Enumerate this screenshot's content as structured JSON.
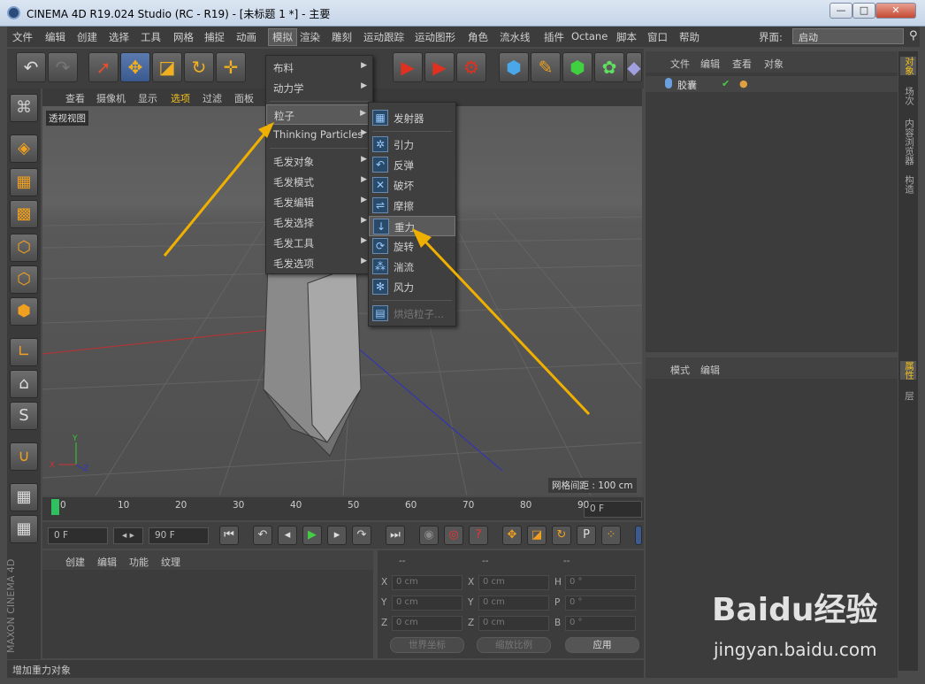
{
  "window": {
    "title": "CINEMA 4D R19.024 Studio (RC - R19) - [未标题 1 *] - 主要"
  },
  "menubar": {
    "items": [
      "文件",
      "编辑",
      "创建",
      "选择",
      "工具",
      "网格",
      "捕捉",
      "动画",
      "模拟",
      "渲染",
      "雕刻",
      "运动跟踪",
      "运动图形",
      "角色",
      "流水线",
      "插件",
      "Octane",
      "脚本",
      "窗口",
      "帮助"
    ],
    "open_item": "模拟",
    "layout_label": "界面:",
    "layout_value": "启动"
  },
  "viewport_bar": {
    "items": [
      "查看",
      "摄像机",
      "显示",
      "选项",
      "过滤",
      "面板"
    ],
    "active": "选项"
  },
  "viewport": {
    "label": "透视视图",
    "grid_info": "网格间距 : 100 cm",
    "axis_labels": [
      "Y",
      "X",
      "Z"
    ]
  },
  "simulate_menu": {
    "items": [
      {
        "label": "布料",
        "submenu": true
      },
      {
        "label": "动力学",
        "submenu": true
      },
      {
        "label": "粒子",
        "submenu": true,
        "selected": true
      },
      {
        "label": "Thinking Particles",
        "submenu": true
      },
      {
        "label": "毛发对象",
        "submenu": true
      },
      {
        "label": "毛发模式",
        "submenu": true
      },
      {
        "label": "毛发编辑",
        "submenu": true
      },
      {
        "label": "毛发选择",
        "submenu": true
      },
      {
        "label": "毛发工具",
        "submenu": true
      },
      {
        "label": "毛发选项",
        "submenu": true
      }
    ]
  },
  "particles_menu": {
    "items": [
      {
        "label": "发射器",
        "icon": "emitter-icon"
      },
      {
        "label": "引力",
        "icon": "attractor-icon"
      },
      {
        "label": "反弹",
        "icon": "deflector-icon"
      },
      {
        "label": "破坏",
        "icon": "destructor-icon"
      },
      {
        "label": "摩擦",
        "icon": "friction-icon"
      },
      {
        "label": "重力",
        "icon": "gravity-icon",
        "hovered": true
      },
      {
        "label": "旋转",
        "icon": "rotation-icon"
      },
      {
        "label": "湍流",
        "icon": "turbulence-icon"
      },
      {
        "label": "风力",
        "icon": "wind-icon"
      },
      {
        "label": "烘焙粒子...",
        "icon": "bake-icon",
        "disabled": true
      }
    ]
  },
  "timeline": {
    "ticks": [
      "0",
      "10",
      "20",
      "30",
      "40",
      "50",
      "60",
      "70",
      "80",
      "90"
    ],
    "current_frame": "0 F"
  },
  "playback": {
    "start": "0 F",
    "end": "90 F"
  },
  "material_panel": {
    "menu": [
      "创建",
      "编辑",
      "功能",
      "纹理"
    ]
  },
  "coord_panel": {
    "headers": [
      "--",
      "--",
      "--"
    ],
    "rows": [
      {
        "a": "X",
        "av": "0 cm",
        "b": "X",
        "bv": "0 cm",
        "c": "H",
        "cv": "0 °"
      },
      {
        "a": "Y",
        "av": "0 cm",
        "b": "Y",
        "bv": "0 cm",
        "c": "P",
        "cv": "0 °"
      },
      {
        "a": "Z",
        "av": "0 cm",
        "b": "Z",
        "bv": "0 cm",
        "c": "B",
        "cv": "0 °"
      }
    ],
    "space": "世界坐标",
    "scale": "缩放比例",
    "apply": "应用"
  },
  "status": "增加重力对象",
  "object_manager": {
    "menu": [
      "文件",
      "编辑",
      "查看",
      "对象"
    ],
    "objects": [
      {
        "name": "胶囊"
      }
    ]
  },
  "attribute_manager": {
    "menu": [
      "模式",
      "编辑"
    ]
  },
  "right_tabs": [
    "对象",
    "场次",
    "内容浏览器",
    "构造",
    "属性",
    "层"
  ],
  "branding": {
    "maxon": "MAXON CINEMA 4D"
  },
  "watermark": {
    "logo": "Baidu经验",
    "url": "jingyan.baidu.com"
  },
  "colors": {
    "accent": "#f0c020",
    "arrow": "#f0b000",
    "background": "#4a4a4a"
  }
}
